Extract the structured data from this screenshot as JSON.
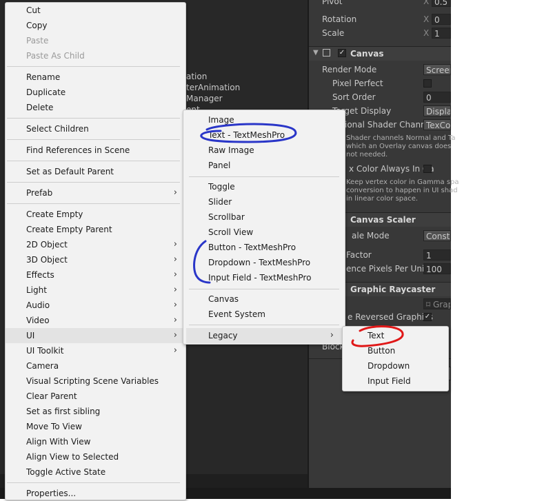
{
  "hierarchy": {
    "partial_items": [
      "ation",
      "terAnimation",
      "Manager",
      "ent"
    ]
  },
  "inspector": {
    "pivot_label": "Pivot",
    "pivot_x_axis": "X",
    "pivot_x_value": "0.5",
    "rotation_label": "Rotation",
    "rotation_axis": "X",
    "rotation_value": "0",
    "scale_label": "Scale",
    "scale_axis": "X",
    "scale_value": "1",
    "canvas": {
      "title": "Canvas",
      "render_mode_label": "Render Mode",
      "render_mode_value": "Screen",
      "pixel_perfect_label": "Pixel Perfect",
      "sort_order_label": "Sort Order",
      "sort_order_value": "0",
      "target_display_label": "Target Display",
      "target_display_value": "Display",
      "shader_channels_label": "ional Shader Channe",
      "shader_channels_value": "TexCo",
      "shader_help_1": "Shader channels Normal and Ta",
      "shader_help_2": "which an Overlay canvas does",
      "shader_help_3": "not needed.",
      "vertex_color_label": "x Color Always In Ga",
      "vertex_help_1": "Keep vertex color in Gamma spa",
      "vertex_help_2": "conversion to happen in UI shad",
      "vertex_help_3": "in linear color space."
    },
    "canvas_scaler": {
      "title": "Canvas Scaler",
      "scale_mode_label": "ale Mode",
      "scale_mode_value": "Consta",
      "factor_label": "Factor",
      "factor_value": "1",
      "ref_pixels_label": "ence Pixels Per Unit",
      "ref_pixels_value": "100"
    },
    "graphic_raycaster": {
      "title": "Graphic Raycaster",
      "script_value": "Grap",
      "reversed_label": "e Reversed Graphics",
      "blocking_label": "Block"
    }
  },
  "context_menu": {
    "items": [
      {
        "label": "Cut"
      },
      {
        "label": "Copy"
      },
      {
        "label": "Paste"
      },
      {
        "label": "Paste As Child"
      },
      {
        "label": "Rename"
      },
      {
        "label": "Duplicate"
      },
      {
        "label": "Delete"
      },
      {
        "label": "Select Children"
      },
      {
        "label": "Find References in Scene"
      },
      {
        "label": "Set as Default Parent"
      },
      {
        "label": "Prefab"
      },
      {
        "label": "Create Empty"
      },
      {
        "label": "Create Empty Parent"
      },
      {
        "label": "2D Object"
      },
      {
        "label": "3D Object"
      },
      {
        "label": "Effects"
      },
      {
        "label": "Light"
      },
      {
        "label": "Audio"
      },
      {
        "label": "Video"
      },
      {
        "label": "UI"
      },
      {
        "label": "UI Toolkit"
      },
      {
        "label": "Camera"
      },
      {
        "label": "Visual Scripting Scene Variables"
      },
      {
        "label": "Clear Parent"
      },
      {
        "label": "Set as first sibling"
      },
      {
        "label": "Move To View"
      },
      {
        "label": "Align With View"
      },
      {
        "label": "Align View to Selected"
      },
      {
        "label": "Toggle Active State"
      },
      {
        "label": "Properties..."
      }
    ],
    "submenu_arrow": "›"
  },
  "ui_submenu": {
    "items": [
      {
        "label": "Image"
      },
      {
        "label": "Text - TextMeshPro"
      },
      {
        "label": "Raw Image"
      },
      {
        "label": "Panel"
      },
      {
        "label": "Toggle"
      },
      {
        "label": "Slider"
      },
      {
        "label": "Scrollbar"
      },
      {
        "label": "Scroll View"
      },
      {
        "label": "Button - TextMeshPro"
      },
      {
        "label": "Dropdown - TextMeshPro"
      },
      {
        "label": "Input Field - TextMeshPro"
      },
      {
        "label": "Canvas"
      },
      {
        "label": "Event System"
      },
      {
        "label": "Legacy"
      }
    ]
  },
  "legacy_submenu": {
    "items": [
      {
        "label": "Text"
      },
      {
        "label": "Button"
      },
      {
        "label": "Dropdown"
      },
      {
        "label": "Input Field"
      }
    ]
  },
  "colors": {
    "menu_bg": "#f2f2f2",
    "highlight": "#e3e3e3",
    "annotation_blue": "#2a36c8",
    "annotation_red": "#e01818"
  }
}
